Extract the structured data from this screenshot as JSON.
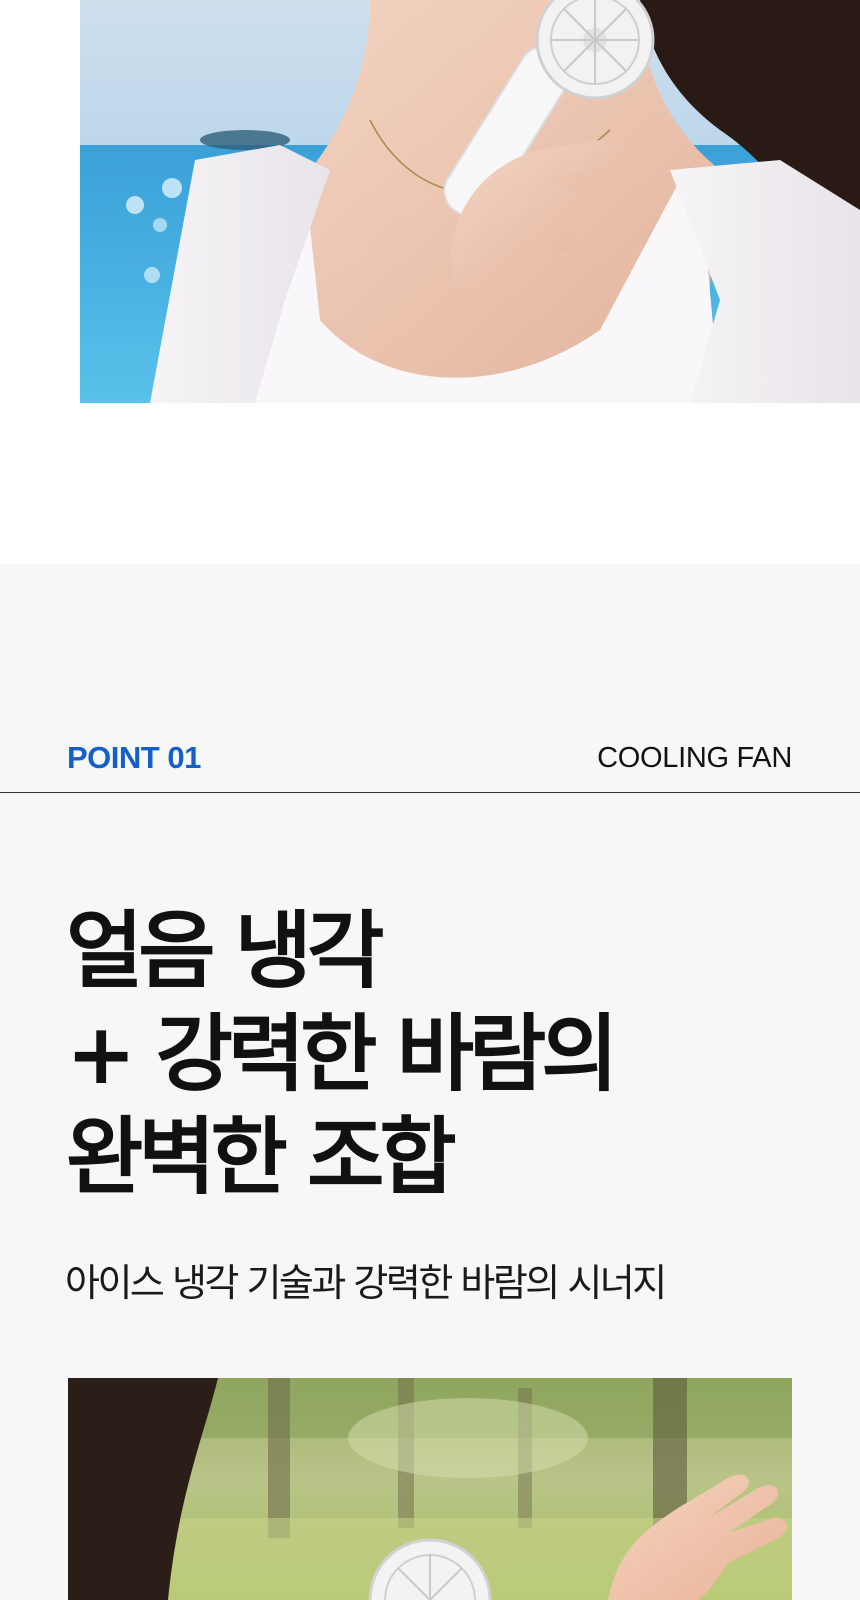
{
  "hero_image": {
    "subject": "woman holding white handheld fan by the sea"
  },
  "point_section": {
    "point_label": "POINT 01",
    "category_label": "COOLING FAN",
    "headline_lines": [
      "얼음 냉각",
      "+ 강력한 바람의",
      "완벽한 조합"
    ],
    "subcopy": "아이스 냉각 기술과 강력한 바람의 시너지"
  },
  "bottom_image": {
    "subject": "woman with handheld fan in a park"
  },
  "colors": {
    "accent": "#1560c8",
    "section_background": "#f7f7f7",
    "text_primary": "#111111"
  }
}
